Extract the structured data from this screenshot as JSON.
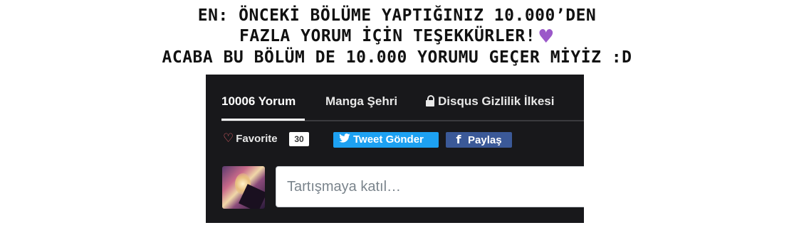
{
  "caption": {
    "line1": "EN: ÖNCEKİ BÖLÜME YAPTIĞINIZ 10.000’DEN",
    "line2": "FAZLA YORUM İÇİN TEŞEKKÜRLER!",
    "line3": "ACABA BU BÖLÜM DE 10.000 YORUMU GEÇER MİYİZ :D",
    "heart_icon": "purple-heart-icon",
    "heart_glyph": "♥",
    "heart_color": "#9b59c9"
  },
  "disqus": {
    "nav": {
      "comments_tab": "10006 Yorum",
      "community_tab": "Manga Şehri",
      "privacy_tab": "Disqus Gizlilik İlkesi",
      "privacy_icon": "lock-icon"
    },
    "actions": {
      "favorite_icon": "heart-outline-icon",
      "favorite_glyph": "♡",
      "favorite_label": "Favorite",
      "favorite_count": "30",
      "tweet_icon": "twitter-bird-icon",
      "tweet_glyph": "🐦",
      "tweet_label": "Tweet Gönder",
      "share_icon": "facebook-icon",
      "share_glyph": "f",
      "share_label": "Paylaş"
    },
    "comment": {
      "placeholder": "Tartışmaya katıl…"
    },
    "colors": {
      "panel_background": "#18181b",
      "twitter": "#1da1f2",
      "facebook": "#3b5998",
      "favorite_heart": "#e8636a"
    }
  }
}
